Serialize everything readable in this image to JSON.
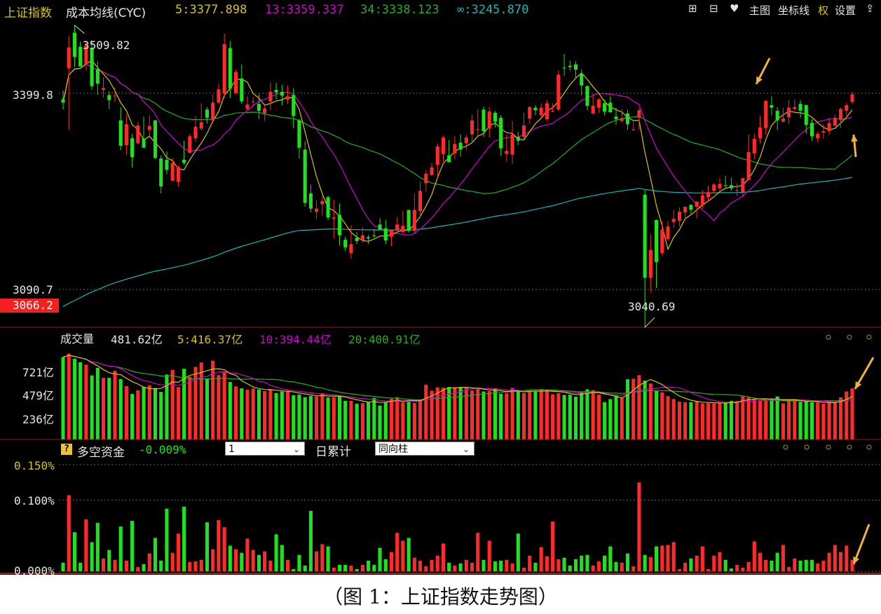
{
  "colors": {
    "up": "#ff2b2b",
    "down": "#1ee21e",
    "ma5": "#d9c400",
    "ma13": "#d400d4",
    "ma34": "#20b020",
    "ma_inf": "#10b8b8",
    "vol5": "#d9c400",
    "vol10": "#d400d4",
    "vol20": "#20b020",
    "arrow": "#f3b23b"
  },
  "header": {
    "title": "上证指数",
    "indicator": "成本均线(CYC)",
    "ma5": "5:3377.898",
    "ma13": "13:3359.337",
    "ma34": "34:3338.123",
    "ma_inf": "∞:3245.870"
  },
  "toolbar": {
    "zoom_in": "⊞",
    "zoom_out": "⊟",
    "favorite": "♥",
    "main": "主图",
    "axis": "坐标线",
    "right": "权",
    "settings": "设置",
    "export": "⇪"
  },
  "price_panel": {
    "high_label": "3509.82",
    "low_label": "3040.69",
    "price_ticks": [
      "3399.8",
      "3090.7"
    ],
    "current_price": "3066.2"
  },
  "volume_panel": {
    "title": "成交量",
    "value": "481.62亿",
    "ma5": "5:416.37亿",
    "ma10": "10:394.44亿",
    "ma20": "20:400.91亿",
    "ticks": [
      "721亿",
      "479亿",
      "236亿"
    ]
  },
  "fund_panel": {
    "help": "?",
    "title": "多空资金",
    "value": "-0.009%",
    "period_select": "1",
    "mode_label": "日累计",
    "style_select": "同向柱",
    "ticks": [
      "0.150%",
      "0.100%",
      "0.000%"
    ]
  },
  "caption": "（图 1：上证指数走势图）",
  "chart_data": [
    {
      "type": "candlestick",
      "y_axis_ticks": [
        3399.8,
        3090.7
      ],
      "y_range": [
        3030,
        3520
      ],
      "annotated_high": 3509.82,
      "annotated_low": 3040.69,
      "series": [
        {
          "name": "5",
          "last": 3377.898
        },
        {
          "name": "13",
          "last": 3359.337
        },
        {
          "name": "34",
          "last": 3338.123
        },
        {
          "name": "∞",
          "last": 3245.87
        }
      ],
      "candles": [
        [
          3390,
          3385,
          3404,
          3374
        ],
        [
          3439,
          3472,
          3490,
          3342
        ],
        [
          3495,
          3457,
          3507,
          3441
        ],
        [
          3473,
          3442,
          3481,
          3442
        ],
        [
          3446,
          3475,
          3481,
          3436
        ],
        [
          3471,
          3411,
          3483,
          3405
        ],
        [
          3438,
          3415,
          3450,
          3397
        ],
        [
          3405,
          3408,
          3425,
          3393
        ],
        [
          3397,
          3389,
          3403,
          3375
        ],
        [
          3395,
          3396,
          3409,
          3386
        ],
        [
          3357,
          3317,
          3378,
          3310
        ],
        [
          3318,
          3351,
          3366,
          3303
        ],
        [
          3329,
          3299,
          3336,
          3283
        ],
        [
          3321,
          3349,
          3355,
          3320
        ],
        [
          3328,
          3314,
          3363,
          3314
        ],
        [
          3342,
          3348,
          3365,
          3330
        ],
        [
          3357,
          3298,
          3358,
          3296
        ],
        [
          3297,
          3253,
          3302,
          3242
        ],
        [
          3295,
          3279,
          3308,
          3272
        ],
        [
          3262,
          3290,
          3298,
          3261
        ],
        [
          3260,
          3284,
          3286,
          3252
        ],
        [
          3295,
          3290,
          3325,
          3287
        ],
        [
          3306,
          3332,
          3336,
          3305
        ],
        [
          3329,
          3347,
          3364,
          3323
        ],
        [
          3344,
          3354,
          3384,
          3341
        ],
        [
          3374,
          3361,
          3378,
          3352
        ],
        [
          3357,
          3385,
          3398,
          3357
        ],
        [
          3385,
          3406,
          3415,
          3382
        ],
        [
          3399,
          3477,
          3494,
          3392
        ],
        [
          3471,
          3407,
          3482,
          3392
        ],
        [
          3400,
          3433,
          3437,
          3399
        ],
        [
          3423,
          3387,
          3445,
          3383
        ],
        [
          3375,
          3382,
          3395,
          3373
        ],
        [
          3386,
          3387,
          3393,
          3378
        ],
        [
          3383,
          3372,
          3399,
          3359
        ],
        [
          3368,
          3376,
          3384,
          3356
        ],
        [
          3387,
          3402,
          3417,
          3373
        ],
        [
          3405,
          3401,
          3416,
          3390
        ],
        [
          3402,
          3396,
          3413,
          3381
        ],
        [
          3390,
          3395,
          3412,
          3383
        ],
        [
          3397,
          3364,
          3408,
          3345
        ],
        [
          3357,
          3314,
          3359,
          3297
        ],
        [
          3311,
          3227,
          3324,
          3221
        ],
        [
          3242,
          3218,
          3256,
          3212
        ],
        [
          3213,
          3218,
          3231,
          3202
        ],
        [
          3225,
          3230,
          3238,
          3207
        ],
        [
          3236,
          3204,
          3239,
          3200
        ],
        [
          3202,
          3204,
          3232,
          3171
        ],
        [
          3208,
          3176,
          3226,
          3160
        ],
        [
          3169,
          3157,
          3174,
          3151
        ],
        [
          3148,
          3162,
          3192,
          3139
        ],
        [
          3172,
          3167,
          3181,
          3162
        ],
        [
          3168,
          3176,
          3189,
          3164
        ],
        [
          3173,
          3171,
          3177,
          3162
        ],
        [
          3176,
          3175,
          3186,
          3172
        ],
        [
          3193,
          3185,
          3203,
          3185
        ],
        [
          3187,
          3168,
          3200,
          3162
        ],
        [
          3174,
          3184,
          3185,
          3159
        ],
        [
          3185,
          3193,
          3205,
          3180
        ],
        [
          3181,
          3191,
          3214,
          3180
        ],
        [
          3216,
          3183,
          3216,
          3180
        ],
        [
          3183,
          3216,
          3241,
          3178
        ],
        [
          3214,
          3246,
          3261,
          3203
        ],
        [
          3258,
          3273,
          3279,
          3245
        ],
        [
          3271,
          3283,
          3290,
          3270
        ],
        [
          3287,
          3316,
          3321,
          3265
        ],
        [
          3304,
          3330,
          3333,
          3292
        ],
        [
          3302,
          3291,
          3326,
          3292
        ],
        [
          3305,
          3320,
          3332,
          3296
        ],
        [
          3322,
          3311,
          3335,
          3300
        ],
        [
          3321,
          3330,
          3334,
          3311
        ],
        [
          3335,
          3357,
          3366,
          3321
        ],
        [
          3343,
          3343,
          3375,
          3330
        ],
        [
          3374,
          3340,
          3379,
          3331
        ],
        [
          3344,
          3371,
          3378,
          3330
        ],
        [
          3369,
          3355,
          3372,
          3346
        ],
        [
          3361,
          3313,
          3365,
          3301
        ],
        [
          3304,
          3309,
          3335,
          3292
        ],
        [
          3303,
          3335,
          3356,
          3289
        ],
        [
          3331,
          3325,
          3339,
          3318
        ],
        [
          3331,
          3349,
          3369,
          3327
        ],
        [
          3360,
          3378,
          3380,
          3351
        ],
        [
          3377,
          3373,
          3381,
          3365
        ],
        [
          3365,
          3377,
          3384,
          3362
        ],
        [
          3359,
          3384,
          3389,
          3356
        ],
        [
          3372,
          3372,
          3384,
          3370
        ],
        [
          3374,
          3429,
          3436,
          3372
        ],
        [
          3440,
          3439,
          3462,
          3427
        ],
        [
          3443,
          3441,
          3451,
          3435
        ],
        [
          3445,
          3437,
          3450,
          3423
        ],
        [
          3431,
          3412,
          3437,
          3397
        ],
        [
          3411,
          3380,
          3412,
          3373
        ],
        [
          3368,
          3380,
          3399,
          3366
        ],
        [
          3377,
          3390,
          3392,
          3369
        ],
        [
          3384,
          3371,
          3390,
          3365
        ],
        [
          3385,
          3370,
          3395,
          3369
        ],
        [
          3363,
          3359,
          3377,
          3350
        ],
        [
          3356,
          3360,
          3375,
          3354
        ],
        [
          3368,
          3351,
          3374,
          3342
        ],
        [
          3342,
          3343,
          3355,
          3340
        ],
        [
          3361,
          3373,
          3377,
          3342
        ],
        [
          3240,
          3109,
          3247,
          3031
        ],
        [
          3109,
          3153,
          3177,
          3086
        ],
        [
          3200,
          3134,
          3201,
          3093
        ],
        [
          3148,
          3185,
          3198,
          3144
        ],
        [
          3170,
          3190,
          3199,
          3167
        ],
        [
          3197,
          3202,
          3216,
          3188
        ],
        [
          3199,
          3213,
          3220,
          3190
        ],
        [
          3212,
          3221,
          3221,
          3199
        ],
        [
          3224,
          3216,
          3225,
          3210
        ],
        [
          3221,
          3229,
          3230,
          3203
        ],
        [
          3223,
          3239,
          3247,
          3218
        ],
        [
          3236,
          3244,
          3254,
          3229
        ],
        [
          3246,
          3256,
          3258,
          3242
        ],
        [
          3250,
          3257,
          3266,
          3247
        ],
        [
          3255,
          3254,
          3270,
          3250
        ],
        [
          3255,
          3250,
          3267,
          3246
        ],
        [
          3247,
          3247,
          3258,
          3238
        ],
        [
          3244,
          3266,
          3267,
          3236
        ],
        [
          3263,
          3307,
          3335,
          3263
        ],
        [
          3305,
          3328,
          3336,
          3296
        ],
        [
          3329,
          3346,
          3364,
          3321
        ],
        [
          3345,
          3388,
          3388,
          3334
        ],
        [
          3381,
          3377,
          3395,
          3365
        ],
        [
          3372,
          3357,
          3378,
          3342
        ],
        [
          3355,
          3360,
          3377,
          3354
        ],
        [
          3362,
          3377,
          3389,
          3351
        ],
        [
          3375,
          3378,
          3390,
          3372
        ],
        [
          3383,
          3372,
          3389,
          3361
        ],
        [
          3381,
          3350,
          3382,
          3336
        ],
        [
          3353,
          3332,
          3359,
          3325
        ],
        [
          3329,
          3336,
          3339,
          3322
        ],
        [
          3338,
          3340,
          3351,
          3328
        ],
        [
          3340,
          3353,
          3361,
          3334
        ],
        [
          3349,
          3361,
          3366,
          3347
        ],
        [
          3358,
          3375,
          3377,
          3345
        ],
        [
          3372,
          3381,
          3385,
          3365
        ],
        [
          3386,
          3398,
          3402,
          3383
        ]
      ]
    },
    {
      "type": "bar",
      "series_name": "成交量",
      "unit": "亿",
      "y_axis_ticks": [
        721,
        479,
        236
      ],
      "last": 481.62,
      "ma": {
        "5": 416.37,
        "10": 394.44,
        "20": 400.91
      },
      "values": [
        848,
        884,
        832,
        795,
        770,
        659,
        737,
        634,
        634,
        706,
        621,
        549,
        467,
        505,
        541,
        557,
        529,
        488,
        668,
        716,
        538,
        727,
        646,
        746,
        792,
        628,
        811,
        661,
        693,
        591,
        545,
        525,
        510,
        523,
        513,
        496,
        516,
        477,
        492,
        498,
        455,
        461,
        434,
        447,
        440,
        475,
        430,
        435,
        445,
        396,
        395,
        366,
        372,
        385,
        427,
        348,
        380,
        417,
        434,
        381,
        388,
        373,
        406,
        563,
        501,
        536,
        532,
        537,
        535,
        538,
        536,
        503,
        518,
        493,
        498,
        526,
        470,
        474,
        530,
        494,
        475,
        495,
        496,
        518,
        509,
        464,
        474,
        457,
        460,
        438,
        493,
        515,
        507,
        460,
        383,
        414,
        450,
        425,
        619,
        624,
        661,
        605,
        575,
        497,
        483,
        445,
        415,
        388,
        381,
        383,
        389,
        370,
        372,
        367,
        376,
        378,
        395,
        392,
        441,
        432,
        415,
        404,
        395,
        421,
        442,
        370,
        403,
        396,
        387,
        393,
        381,
        379,
        367,
        379,
        385,
        432,
        493,
        524
      ]
    },
    {
      "type": "bar",
      "series_name": "多空资金",
      "unit": "%",
      "y_axis_ticks": [
        0.15,
        0.1,
        0.0
      ],
      "last": -0.009,
      "values": [
        0.012,
        0.107,
        0.055,
        0.012,
        0.073,
        0.041,
        0.068,
        0.018,
        0.03,
        0.016,
        0.063,
        0.015,
        0.071,
        0.006,
        0.01,
        0.025,
        0.047,
        0.015,
        0.088,
        0.026,
        0.053,
        0.091,
        0.013,
        0.014,
        0.016,
        0.069,
        0.031,
        0.072,
        0.062,
        0.036,
        0.031,
        0.026,
        0.046,
        0.03,
        0.023,
        0.028,
        0.015,
        0.052,
        0.037,
        0.016,
        0.003,
        0.023,
        0.008,
        0.085,
        0.028,
        0.038,
        0.035,
        0.005,
        0.009,
        0.009,
        0.008,
        0.003,
        0.009,
        0.015,
        0.009,
        0.033,
        0.017,
        0.027,
        0.054,
        0.043,
        0.047,
        0.019,
        0.015,
        0.007,
        0.016,
        0.022,
        0.039,
        0.012,
        0.008,
        0.011,
        0.016,
        0.012,
        0.054,
        0.016,
        0.043,
        0.014,
        0.015,
        0.016,
        0.011,
        0.053,
        0.005,
        0.022,
        0.012,
        0.034,
        0.021,
        0.07,
        0.017,
        0.019,
        0.008,
        0.017,
        0.022,
        0.023,
        0.008,
        0.014,
        0.022,
        0.035,
        0.013,
        0.012,
        0.025,
        0.007,
        0.125,
        0.023,
        0.02,
        0.035,
        0.036,
        0.037,
        0.041,
        0.003,
        0.012,
        0.018,
        0.022,
        0.035,
        0.003,
        0.022,
        0.027,
        0.016,
        0.004,
        0.009,
        0.005,
        0.013,
        0.042,
        0.026,
        0.016,
        0.015,
        0.026,
        0.037,
        0.006,
        0.018,
        0.015,
        0.016,
        0.016,
        0.011,
        0.015,
        0.026,
        0.037,
        0.027,
        0.036,
        0.016
      ]
    }
  ]
}
